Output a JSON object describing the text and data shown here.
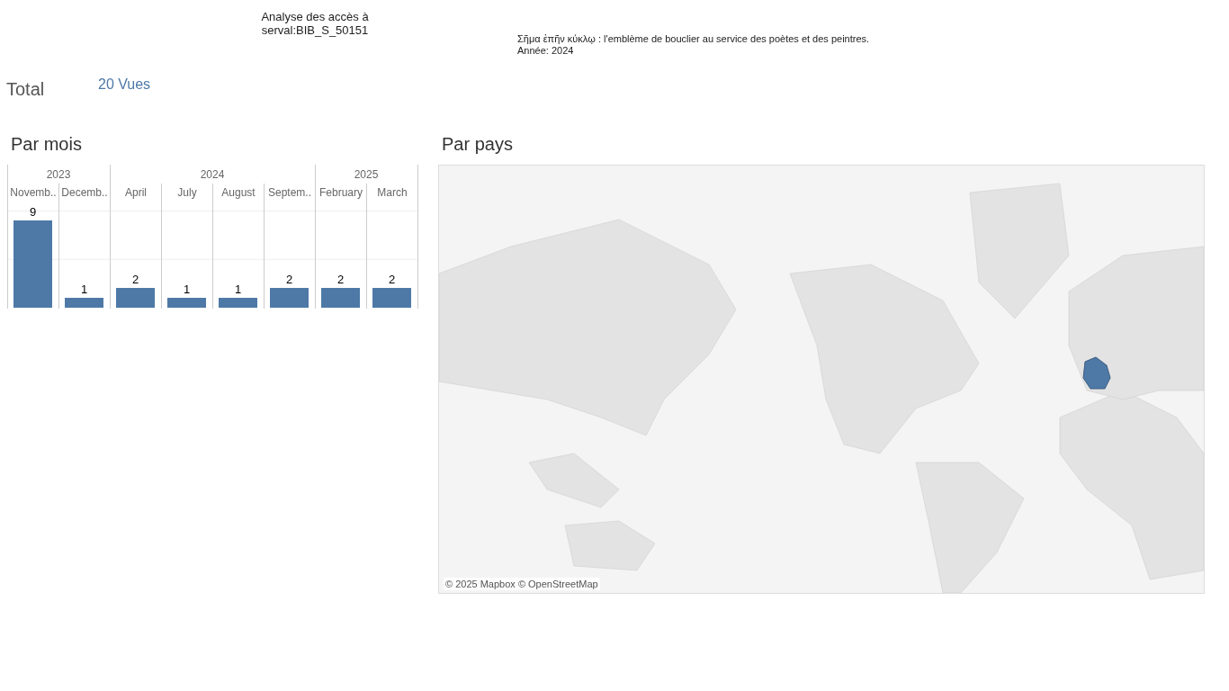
{
  "header": {
    "title": "Analyse des accès à serval:BIB_S_50151",
    "note": "Σῆμα ἐπῆν κύκλῳ : l'emblème de bouclier au service des poètes et des peintres.",
    "year_line": "Année: 2024"
  },
  "total": {
    "label": "Total",
    "value": "20 Vues"
  },
  "by_month": {
    "title": "Par mois",
    "year_groups": [
      {
        "label": "2023",
        "months": [
          "Novemb..",
          "Decemb.."
        ]
      },
      {
        "label": "2024",
        "months": [
          "April",
          "July",
          "August",
          "Septem.."
        ]
      },
      {
        "label": "2025",
        "months": [
          "February",
          "March"
        ]
      }
    ],
    "chart_data": {
      "type": "bar",
      "ref_lines": [
        {
          "axis": "y",
          "value": 5
        },
        {
          "axis": "y",
          "value": 10
        }
      ],
      "series": [
        {
          "color": "#4e79a7",
          "values": [
            9,
            1,
            2,
            1,
            1,
            2,
            2,
            2
          ]
        }
      ],
      "data_labels": true
    }
  },
  "by_country": {
    "title": "Par pays",
    "attribution": "© 2025 Mapbox © OpenStreetMap"
  }
}
